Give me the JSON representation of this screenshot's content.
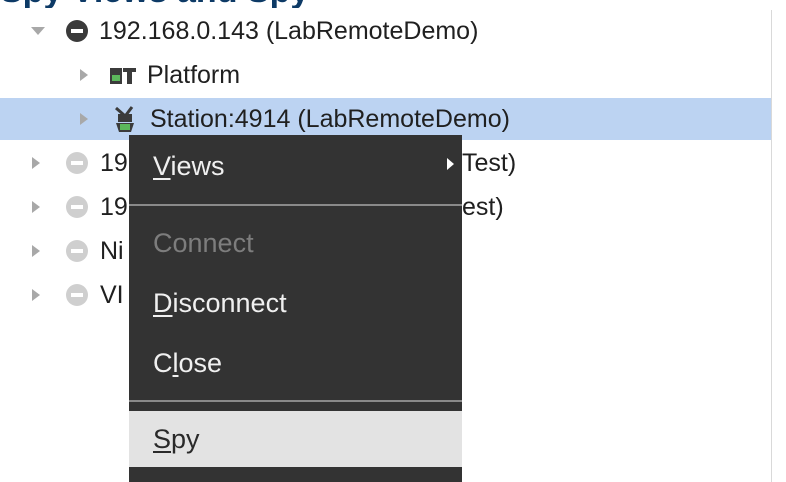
{
  "top_crop_text": "Spy Views and Spy",
  "tree": {
    "rows": [
      {
        "label": "192.168.0.143 (LabRemoteDemo)"
      },
      {
        "label": "Platform"
      },
      {
        "label": "Station:4914 (LabRemoteDemo)"
      },
      {
        "prefix": "19",
        "suffix": "Test)"
      },
      {
        "prefix": "19",
        "suffix": "est)"
      },
      {
        "prefix": "Ni"
      },
      {
        "prefix": "VI"
      }
    ]
  },
  "context_menu": {
    "views": {
      "mnemonic": "V",
      "rest": "iews"
    },
    "connect": "Connect",
    "disconnect": {
      "mnemonic": "D",
      "rest": "isconnect"
    },
    "close": {
      "before": "C",
      "mnemonic": "l",
      "rest": "ose"
    },
    "spy": {
      "mnemonic": "S",
      "rest": "py"
    }
  },
  "colors": {
    "selection": "#bcd3f2",
    "menu_bg": "#333333",
    "menu_hover": "#e3e3e3",
    "disabled_text": "#7d7d7d"
  },
  "icons": [
    "expand-down-icon",
    "expand-right-icon",
    "host-icon",
    "platform-icon",
    "station-icon",
    "submenu-arrow-icon"
  ]
}
